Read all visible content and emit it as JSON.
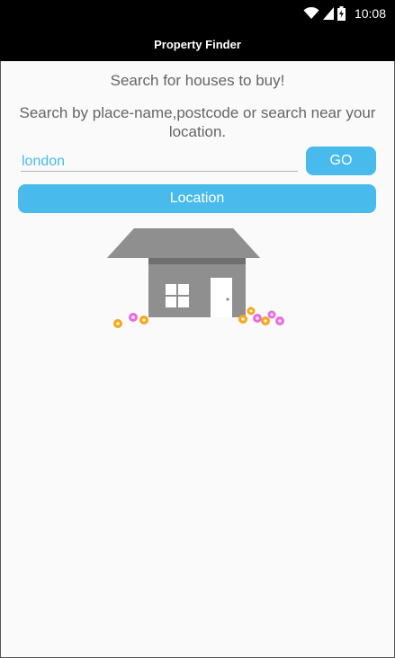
{
  "status_bar": {
    "time": "10:08",
    "icons": [
      "wifi-icon",
      "signal-icon",
      "battery-icon"
    ]
  },
  "nav": {
    "title": "Property Finder"
  },
  "main": {
    "headline": "Search for houses to buy!",
    "instructions": "Search by place-name,postcode or search near your location.",
    "search": {
      "value": "london",
      "placeholder": ""
    },
    "go_label": "GO",
    "location_label": "Location",
    "illustration": "house-image"
  },
  "colors": {
    "accent": "#48bbec",
    "text_muted": "#656565",
    "bar_background": "#000000",
    "house_gray": "#8f8f8f",
    "flower_orange": "#f5a623",
    "flower_pink": "#e66fe0"
  }
}
